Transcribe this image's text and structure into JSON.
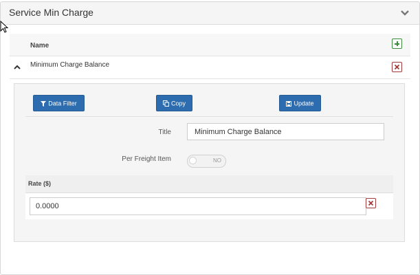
{
  "panel": {
    "title": "Service Min Charge"
  },
  "grid": {
    "columns": {
      "name": "Name"
    },
    "rows": [
      {
        "name": "Minimum Charge Balance"
      }
    ]
  },
  "detail": {
    "buttons": {
      "data_filter": "Data Filter",
      "copy": "Copy",
      "update": "Update"
    },
    "title_label": "Title",
    "title_value": "Minimum Charge Balance",
    "per_freight_label": "Per Freight Item",
    "per_freight_toggle": "NO",
    "rate_header": "Rate ($)",
    "rate_value": "0.0000"
  },
  "colors": {
    "primary_button": "#2d6cae",
    "add_green": "#3c8a3c",
    "delete_red": "#a33a3a"
  },
  "icons": {
    "collapse": "chevron-down-icon",
    "row_toggle": "chevron-up-icon",
    "add": "plus-square-icon",
    "delete": "x-square-icon",
    "filter": "filter-icon",
    "copy": "copy-icon",
    "update": "save-icon"
  }
}
